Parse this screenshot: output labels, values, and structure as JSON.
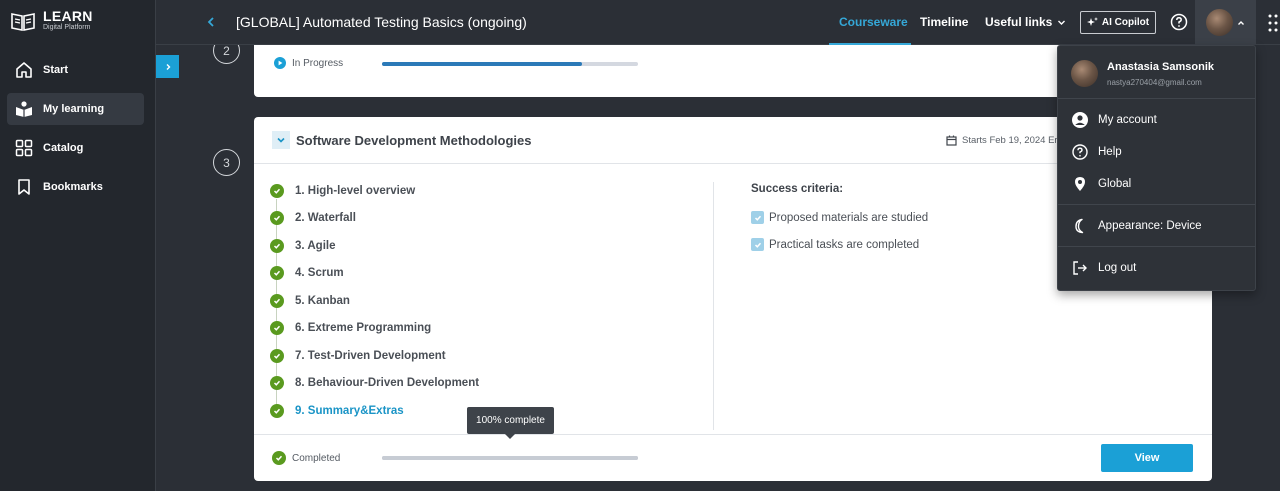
{
  "brand": {
    "title": "LEARN",
    "subtitle": "Digital Platform"
  },
  "sidebar": {
    "items": [
      {
        "label": "Start",
        "icon": "home-icon"
      },
      {
        "label": "My learning",
        "icon": "learning-icon",
        "active": true
      },
      {
        "label": "Catalog",
        "icon": "catalog-icon"
      },
      {
        "label": "Bookmarks",
        "icon": "bookmark-icon"
      }
    ]
  },
  "header": {
    "course_title": "[GLOBAL] Automated Testing Basics (ongoing)",
    "nav": [
      {
        "label": "Courseware",
        "active": true
      },
      {
        "label": "Timeline"
      },
      {
        "label": "Useful links"
      }
    ],
    "ai_button": "AI Copilot"
  },
  "sections": [
    {
      "step": "2",
      "status": "In Progress",
      "progress": 0.78
    },
    {
      "step": "3",
      "title": "Software Development Methodologies",
      "start_date": "Starts Feb 19, 2024 Er",
      "lessons": [
        "1. High-level overview",
        "2. Waterfall",
        "3. Agile",
        "4. Scrum",
        "5. Kanban",
        "6. Extreme Programming",
        "7. Test-Driven Development",
        "8. Behaviour-Driven Development",
        "9. Summary&Extras"
      ],
      "criteria_title": "Success criteria:",
      "criteria": [
        "Proposed materials are studied",
        "Practical tasks are completed"
      ],
      "status": "Completed",
      "progress": 1.0,
      "tooltip": "100% complete",
      "view_button": "View"
    }
  ],
  "user_menu": {
    "name": "Anastasia Samsonik",
    "email": "nastya270404@gmail.com",
    "items": [
      {
        "label": "My account",
        "icon": "account-icon"
      },
      {
        "label": "Help",
        "icon": "help-icon"
      },
      {
        "label": "Global",
        "icon": "location-pin-icon"
      },
      {
        "label": "Appearance: Device",
        "icon": "moon-icon"
      },
      {
        "label": "Log out",
        "icon": "logout-icon"
      }
    ]
  },
  "colors": {
    "accent": "#1ba0d6",
    "success": "#5a9a1f",
    "dark_bg": "#2b2f36"
  }
}
